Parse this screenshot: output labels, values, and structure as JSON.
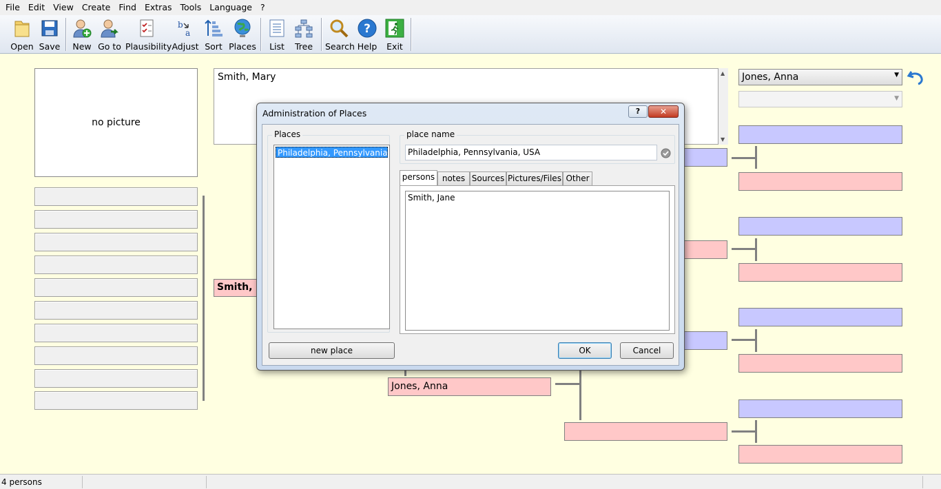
{
  "menu": [
    "File",
    "Edit",
    "View",
    "Create",
    "Find",
    "Extras",
    "Tools",
    "Language",
    "?"
  ],
  "toolbar": {
    "open": "Open",
    "save": "Save",
    "new": "New",
    "goto": "Go to",
    "plausibility": "Plausibility",
    "adjust": "Adjust",
    "sort": "Sort",
    "places": "Places",
    "list": "List",
    "tree": "Tree",
    "search": "Search",
    "help": "Help",
    "exit": "Exit"
  },
  "main": {
    "no_picture": "no picture",
    "person_name": "Smith, Mary",
    "focus_person": "Smith, M",
    "mother_box": "Jones, Anna"
  },
  "right_panel": {
    "person_select": "Jones, Anna",
    "second_select": ""
  },
  "dialog": {
    "title": "Administration of Places",
    "places_label": "Places",
    "places": [
      "Philadelphia, Pennsylvania, USA"
    ],
    "place_name_label": "place name",
    "place_name_value": "Philadelphia, Pennsylvania, USA",
    "tabs": [
      "persons",
      "notes",
      "Sources",
      "Pictures/Files",
      "Other"
    ],
    "persons": [
      "Smith, Jane"
    ],
    "new_place_button": "new place",
    "ok_button": "OK",
    "cancel_button": "Cancel"
  },
  "status": {
    "count": "4 persons"
  },
  "colors": {
    "background": "#ffffe1",
    "male_slot": "#c8c8ff",
    "female_slot": "#ffc8c8",
    "selection": "#3399ff"
  }
}
